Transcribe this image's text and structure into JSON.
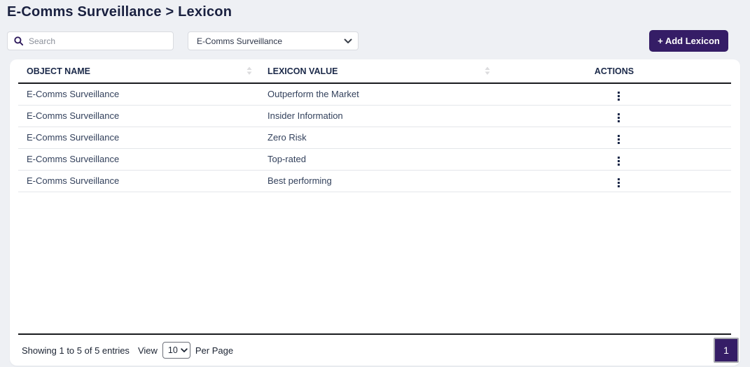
{
  "page": {
    "title": "E-Comms Surveillance > Lexicon",
    "background_color": "#eef0f4",
    "accent_color": "#351d66"
  },
  "toolbar": {
    "search": {
      "placeholder": "Search",
      "value": ""
    },
    "filter_select": {
      "selected_value": "E-Comms Surveillance"
    },
    "add_button_label": "+ Add Lexicon"
  },
  "table": {
    "columns": [
      {
        "label": "OBJECT NAME",
        "sortable": true
      },
      {
        "label": "LEXICON VALUE",
        "sortable": true
      },
      {
        "label": "ACTIONS",
        "sortable": false
      }
    ],
    "rows": [
      {
        "object_name": "E-Comms Surveillance",
        "lexicon_value": "Outperform the Market"
      },
      {
        "object_name": "E-Comms Surveillance",
        "lexicon_value": "Insider Information"
      },
      {
        "object_name": "E-Comms Surveillance",
        "lexicon_value": "Zero Risk"
      },
      {
        "object_name": "E-Comms Surveillance",
        "lexicon_value": "Top-rated"
      },
      {
        "object_name": "E-Comms Surveillance",
        "lexicon_value": "Best performing"
      }
    ]
  },
  "footer": {
    "showing_text": "Showing 1 to 5 of 5 entries",
    "view_label": "View",
    "per_page_selected": "10",
    "per_page_label": "Per Page",
    "pagination": {
      "current_page": "1"
    }
  }
}
